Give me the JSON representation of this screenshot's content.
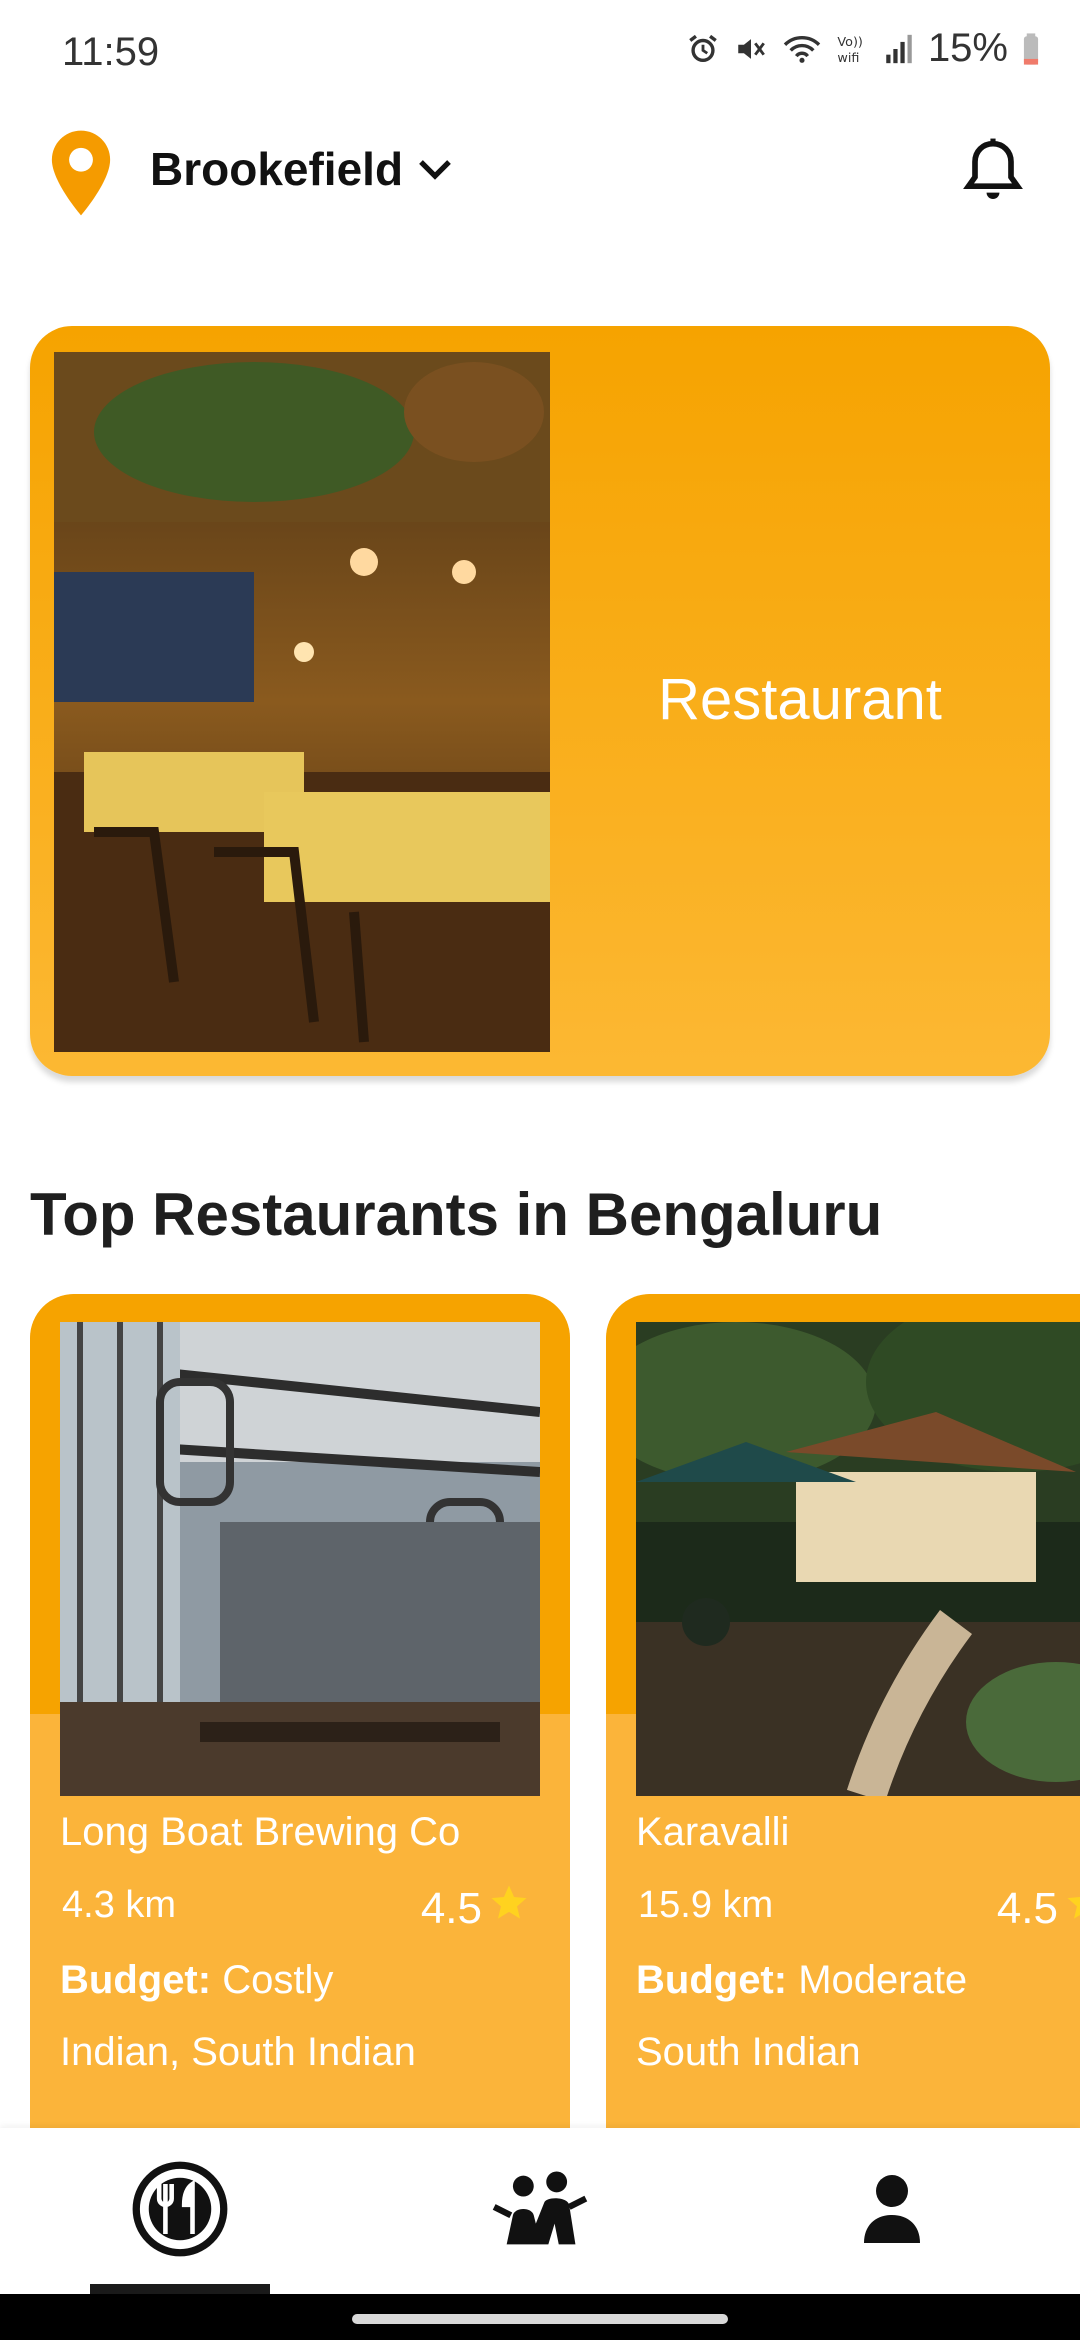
{
  "status_bar": {
    "time": "11:59",
    "battery": "15%",
    "icons": [
      "alarm-icon",
      "mute-icon",
      "wifi-icon",
      "volte-wifi-icon",
      "signal-icon",
      "battery-icon"
    ]
  },
  "header": {
    "location": "Brookefield",
    "icons": [
      "location-pin-icon",
      "chevron-down-icon",
      "bell-icon"
    ]
  },
  "hero": {
    "label": "Restaurant"
  },
  "section": {
    "title": "Top Restaurants in Bengaluru"
  },
  "restaurants": [
    {
      "name": "Long Boat Brewing Co",
      "distance": "4.3 km",
      "rating": "4.5",
      "budget_label": "Budget:",
      "budget_value": " Costly",
      "cuisine": "Indian, South Indian"
    },
    {
      "name": "Karavalli",
      "distance": "15.9 km",
      "rating": "4.5",
      "budget_label": "Budget:",
      "budget_value": " Moderate",
      "cuisine": "South Indian"
    }
  ],
  "bottom_nav": {
    "items": [
      "dining-icon",
      "people-icon",
      "profile-icon"
    ],
    "active": 0
  },
  "colors": {
    "accent": "#f6a300",
    "card_body": "#fbb43a",
    "star": "#ffd21f",
    "pin": "#f59b00"
  }
}
